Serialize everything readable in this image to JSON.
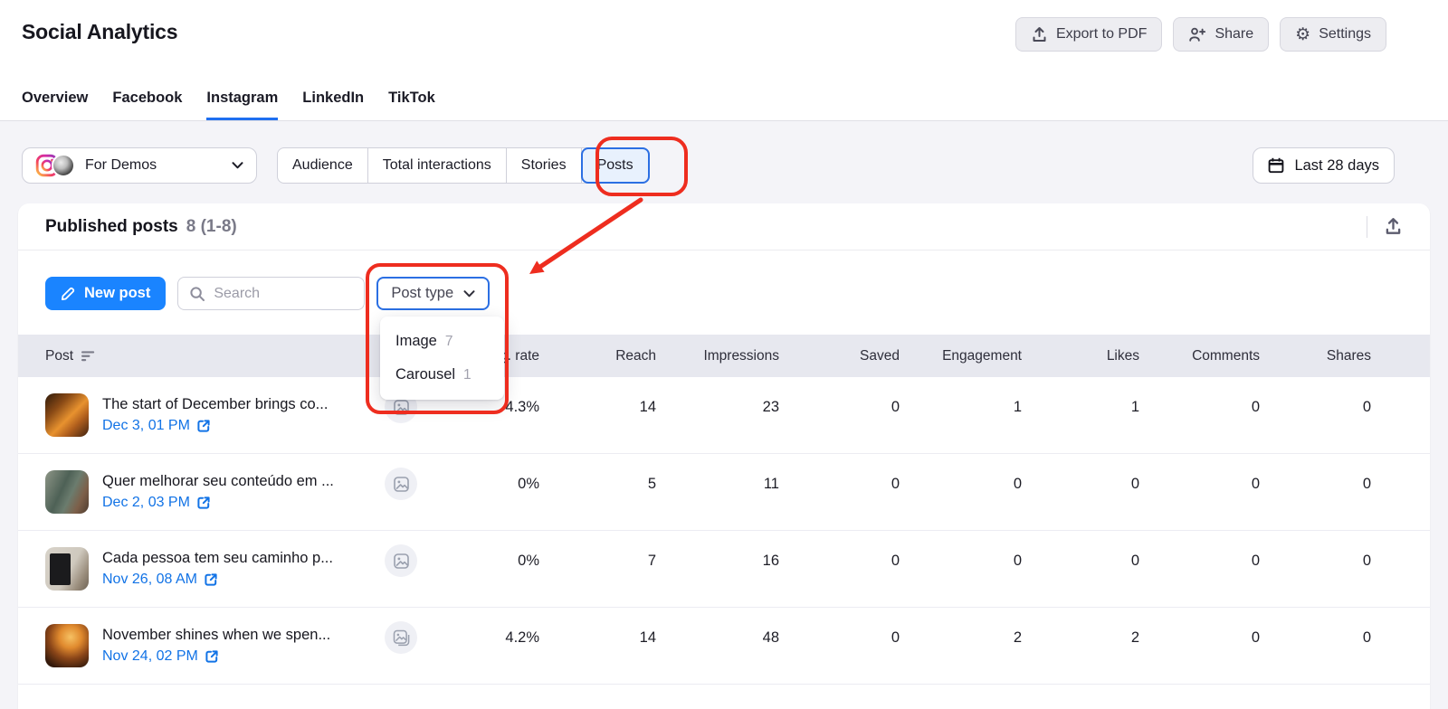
{
  "colors": {
    "accent_blue": "#1a84ff",
    "selected_blue": "#2b6fe3",
    "link_blue": "#1273e6",
    "tab_underline_blue": "#1f6ff0",
    "annotation_red": "#ee2d1f",
    "content_background": "#f4f4f8",
    "table_header_background": "#e7e8ef"
  },
  "header": {
    "title": "Social Analytics",
    "actions": [
      {
        "label": "Export to PDF",
        "icon": "export-pdf-icon"
      },
      {
        "label": "Share",
        "icon": "share-person-plus-icon"
      },
      {
        "label": "Settings",
        "icon": "settings-gear-icon"
      }
    ]
  },
  "icons": {
    "settings_glyph": "⚙"
  },
  "tabs": {
    "items": [
      {
        "label": "Overview"
      },
      {
        "label": "Facebook"
      },
      {
        "label": "Instagram",
        "active": true
      },
      {
        "label": "LinkedIn"
      },
      {
        "label": "TikTok"
      }
    ]
  },
  "filters": {
    "account": {
      "name": "For Demos",
      "network": "instagram"
    },
    "segments": [
      {
        "label": "Audience"
      },
      {
        "label": "Total interactions"
      },
      {
        "label": "Stories"
      },
      {
        "label": "Posts",
        "selected": true
      }
    ],
    "date_range": {
      "label": "Last 28 days"
    }
  },
  "posts_card": {
    "title": "Published posts",
    "count": "8 (1-8)",
    "toolbar": {
      "new_post_label": "New post",
      "search_placeholder": "Search",
      "post_type_label": "Post type"
    },
    "post_type_menu": {
      "items": [
        {
          "label": "Image",
          "count": "7"
        },
        {
          "label": "Carousel",
          "count": "1"
        }
      ]
    },
    "table": {
      "columns": [
        "Post",
        "Eng. rate",
        "Reach",
        "Impressions",
        "Saved",
        "Engagement",
        "Likes",
        "Comments",
        "Shares"
      ],
      "rows": [
        {
          "title": "The start of December brings co...",
          "date": "Dec 3, 01 PM",
          "type": "image",
          "eng_rate": "4.3%",
          "reach": "14",
          "impressions": "23",
          "saved": "0",
          "engagement": "1",
          "likes": "1",
          "comments": "0",
          "shares": "0"
        },
        {
          "title": "Quer melhorar seu conteúdo em ...",
          "date": "Dec 2, 03 PM",
          "type": "image",
          "eng_rate": "0%",
          "reach": "5",
          "impressions": "11",
          "saved": "0",
          "engagement": "0",
          "likes": "0",
          "comments": "0",
          "shares": "0"
        },
        {
          "title": "Cada pessoa tem seu caminho p...",
          "date": "Nov 26, 08 AM",
          "type": "image",
          "eng_rate": "0%",
          "reach": "7",
          "impressions": "16",
          "saved": "0",
          "engagement": "0",
          "likes": "0",
          "comments": "0",
          "shares": "0"
        },
        {
          "title": "November shines when we spen...",
          "date": "Nov 24, 02 PM",
          "type": "carousel",
          "eng_rate": "4.2%",
          "reach": "14",
          "impressions": "48",
          "saved": "0",
          "engagement": "2",
          "likes": "2",
          "comments": "0",
          "shares": "0"
        }
      ]
    }
  }
}
